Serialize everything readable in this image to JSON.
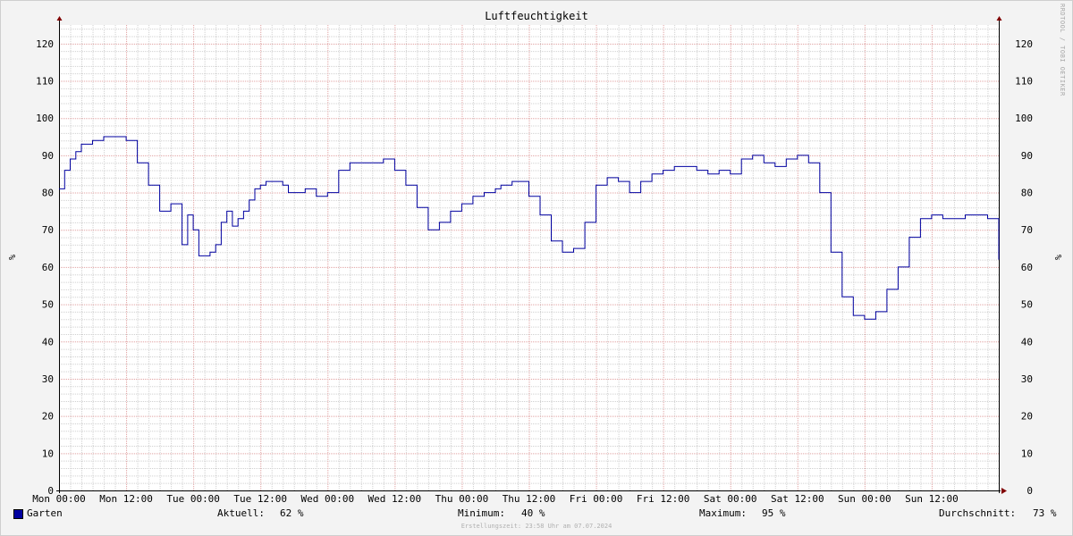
{
  "chart_data": {
    "type": "line",
    "title": "Luftfeuchtigkeit",
    "ylabel": "%",
    "ylabel_right": "%",
    "ylim": [
      0,
      125
    ],
    "yticks": [
      0,
      10,
      20,
      30,
      40,
      50,
      60,
      70,
      80,
      90,
      100,
      110,
      120
    ],
    "xticks": [
      "Mon 00:00",
      "Mon 12:00",
      "Tue 00:00",
      "Tue 12:00",
      "Wed 00:00",
      "Wed 12:00",
      "Thu 00:00",
      "Thu 12:00",
      "Fri 00:00",
      "Fri 12:00",
      "Sat 00:00",
      "Sat 12:00",
      "Sun 00:00",
      "Sun 12:00"
    ],
    "grid": true,
    "colors": {
      "series": "#0000a0",
      "grid_major": "#e0a0a0",
      "grid_minor": "#d0d0d0",
      "axis": "#800000"
    },
    "series": [
      {
        "name": "Garten",
        "hours": [
          0,
          1,
          2,
          3,
          4,
          6,
          8,
          10,
          12,
          14,
          16,
          18,
          20,
          22,
          23,
          24,
          25,
          26,
          27,
          28,
          29,
          30,
          31,
          32,
          33,
          34,
          35,
          36,
          37,
          38,
          39,
          40,
          41,
          42,
          44,
          46,
          48,
          50,
          52,
          54,
          56,
          58,
          60,
          62,
          64,
          66,
          68,
          70,
          72,
          74,
          76,
          78,
          79,
          80,
          81,
          82,
          84,
          86,
          88,
          90,
          92,
          94,
          96,
          98,
          100,
          102,
          104,
          106,
          108,
          110,
          112,
          114,
          116,
          118,
          120,
          122,
          124,
          126,
          128,
          130,
          132,
          134,
          136,
          138,
          140,
          142,
          144,
          146,
          148,
          150,
          152,
          154,
          156,
          158,
          160,
          162,
          164,
          166,
          168
        ],
        "values": [
          81,
          86,
          89,
          91,
          93,
          94,
          95,
          95,
          94,
          88,
          82,
          75,
          77,
          66,
          74,
          70,
          63,
          63,
          64,
          66,
          72,
          75,
          71,
          73,
          75,
          78,
          81,
          82,
          83,
          83,
          83,
          82,
          80,
          80,
          81,
          79,
          80,
          86,
          88,
          88,
          88,
          89,
          86,
          82,
          76,
          70,
          72,
          75,
          77,
          79,
          80,
          81,
          82,
          82,
          83,
          83,
          79,
          74,
          67,
          64,
          65,
          72,
          82,
          84,
          83,
          80,
          83,
          85,
          86,
          87,
          87,
          86,
          85,
          86,
          85,
          89,
          90,
          88,
          87,
          89,
          90,
          88,
          80,
          64,
          52,
          47,
          46,
          48,
          54,
          60,
          68,
          73,
          74,
          73,
          73,
          74,
          74,
          73,
          62
        ]
      }
    ]
  },
  "legend": {
    "series_name": "Garten",
    "current_label": "Aktuell:",
    "current_value": "62 %",
    "minimum_label": "Minimum:",
    "minimum_value": "40 %",
    "maximum_label": "Maximum:",
    "maximum_value": "95 %",
    "average_label": "Durchschnitt:",
    "average_value": "73 %"
  },
  "footer": {
    "created": "Erstellungszeit: 23:58 Uhr am 07.07.2024"
  },
  "watermark": "RRDTOOL / TOBI OETIKER"
}
